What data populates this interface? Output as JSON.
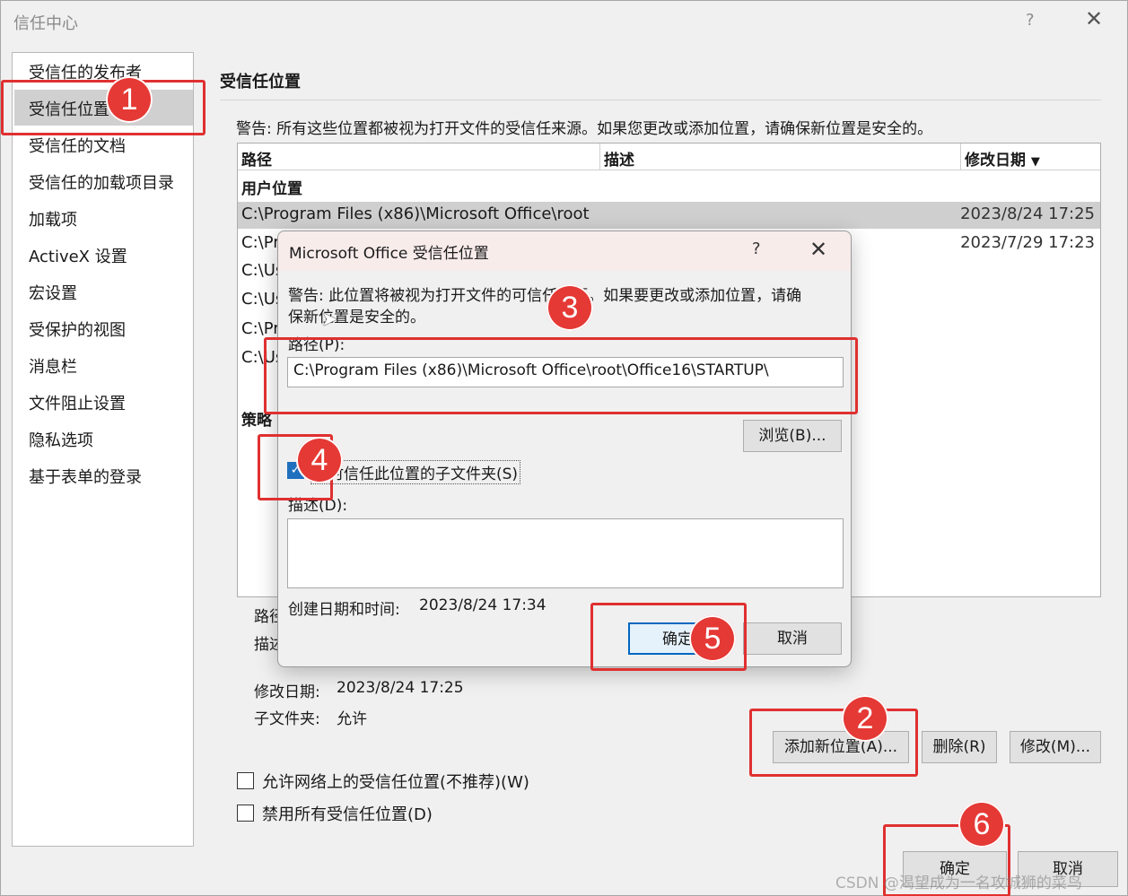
{
  "window": {
    "title": "信任中心",
    "help": "?",
    "close": "✕"
  },
  "sidebar": {
    "items": [
      {
        "label": "受信任的发布者"
      },
      {
        "label": "受信任位置"
      },
      {
        "label": "受信任的文档"
      },
      {
        "label": "受信任的加载项目录"
      },
      {
        "label": "加载项"
      },
      {
        "label": "ActiveX 设置"
      },
      {
        "label": "宏设置"
      },
      {
        "label": "受保护的视图"
      },
      {
        "label": "消息栏"
      },
      {
        "label": "文件阻止设置"
      },
      {
        "label": "隐私选项"
      },
      {
        "label": "基于表单的登录"
      }
    ],
    "selected": "受信任位置"
  },
  "main": {
    "title": "受信任位置",
    "warning": "警告: 所有这些位置都被视为打开文件的受信任来源。如果您更改或添加位置，请确保新位置是安全的。",
    "columns": {
      "path": "路径",
      "desc": "描述",
      "date": "修改日期"
    },
    "sort_icon": "▼",
    "group_label": "用户位置",
    "policy_label": "策略",
    "rows": [
      {
        "path": "C:\\Program Files (x86)\\Microsoft Office\\root",
        "date": "2023/8/24 17:25"
      },
      {
        "path": "C:\\Pr",
        "date": "2023/7/29 17:23"
      },
      {
        "path": "C:\\Us",
        "date": ""
      },
      {
        "path": "C:\\Us",
        "date": ""
      },
      {
        "path": "C:\\Pr",
        "date": ""
      },
      {
        "path": "C:\\Us",
        "date": ""
      }
    ],
    "info": {
      "path_label": "路径",
      "desc_label": "描述",
      "modified_label": "修改日期:",
      "modified_value": "2023/8/24 17:25",
      "subfolder_label": "子文件夹:",
      "subfolder_value": "允许"
    },
    "buttons": {
      "add": "添加新位置(A)...",
      "remove": "删除(R)",
      "modify": "修改(M)..."
    },
    "checkboxes": {
      "network": "允许网络上的受信任位置(不推荐)(W)",
      "disable_all": "禁用所有受信任位置(D)"
    }
  },
  "footer": {
    "ok": "确定",
    "cancel": "取消"
  },
  "dialog": {
    "title": "Microsoft Office 受信任位置",
    "help": "?",
    "close": "✕",
    "warning_line1": "警告: 此位置将被视为打开文件的可信任来源。如果要更改或添加位置，请确",
    "warning_line2": "保新位置是安全的。",
    "path_label": "路径(P):",
    "path_value": "C:\\Program Files (x86)\\Microsoft Office\\root\\Office16\\STARTUP\\",
    "browse": "浏览(B)...",
    "subfolders_label": "同时信任此位置的子文件夹(S)",
    "subfolders_checked": true,
    "desc_label": "描述(D):",
    "desc_value": "",
    "created_label": "创建日期和时间:",
    "created_value": "2023/8/24 17:34",
    "ok": "确定",
    "cancel": "取消"
  },
  "annotations": {
    "badges": [
      "1",
      "2",
      "3",
      "4",
      "5",
      "6"
    ]
  },
  "watermark": "CSDN @渴望成为一名攻城狮的菜鸟"
}
